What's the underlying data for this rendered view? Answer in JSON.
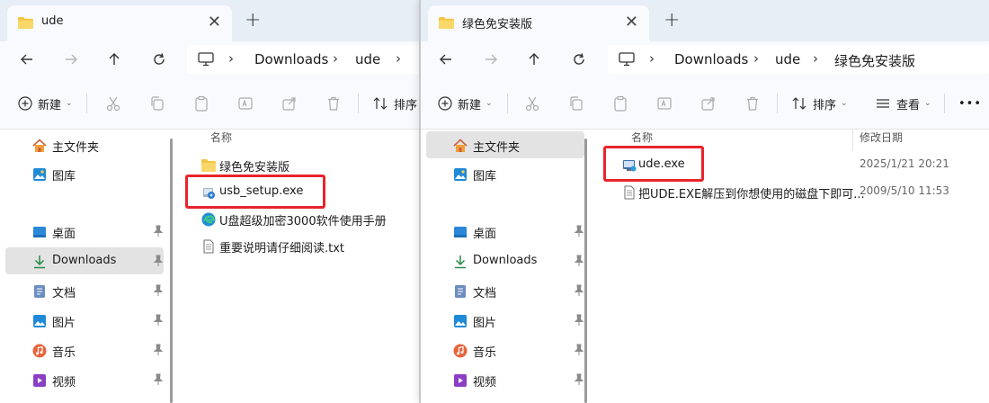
{
  "left_window": {
    "tab_title": "ude",
    "breadcrumb": [
      "Downloads",
      "ude"
    ],
    "toolbar": {
      "new_label": "新建",
      "sort_label": "排序"
    },
    "sidebar": {
      "home": "主文件夹",
      "gallery": "图库",
      "pinned": [
        "桌面",
        "Downloads",
        "文档",
        "图片",
        "音乐",
        "视频"
      ]
    },
    "column_header": "名称",
    "files": [
      "绿色免安装版",
      "usb_setup.exe",
      "U盘超级加密3000软件使用手册",
      "重要说明请仔细阅读.txt"
    ]
  },
  "right_window": {
    "tab_title": "绿色免安装版",
    "breadcrumb": [
      "Downloads",
      "ude",
      "绿色免安装版"
    ],
    "toolbar": {
      "new_label": "新建",
      "sort_label": "排序",
      "view_label": "查看",
      "more_label": "•••"
    },
    "sidebar": {
      "home": "主文件夹",
      "gallery": "图库",
      "pinned": [
        "桌面",
        "Downloads",
        "文档",
        "图片",
        "音乐",
        "视频"
      ]
    },
    "column_headers": {
      "name": "名称",
      "modified": "修改日期"
    },
    "files": [
      {
        "name": "ude.exe",
        "date": "2025/1/21 20:21"
      },
      {
        "name": "把UDE.EXE解压到你想使用的磁盘下即可...",
        "date": "2009/5/10 11:53"
      }
    ]
  },
  "colors": {
    "highlight": "#e8242c",
    "accent": "#0067c0",
    "folder": "#f4c542"
  }
}
